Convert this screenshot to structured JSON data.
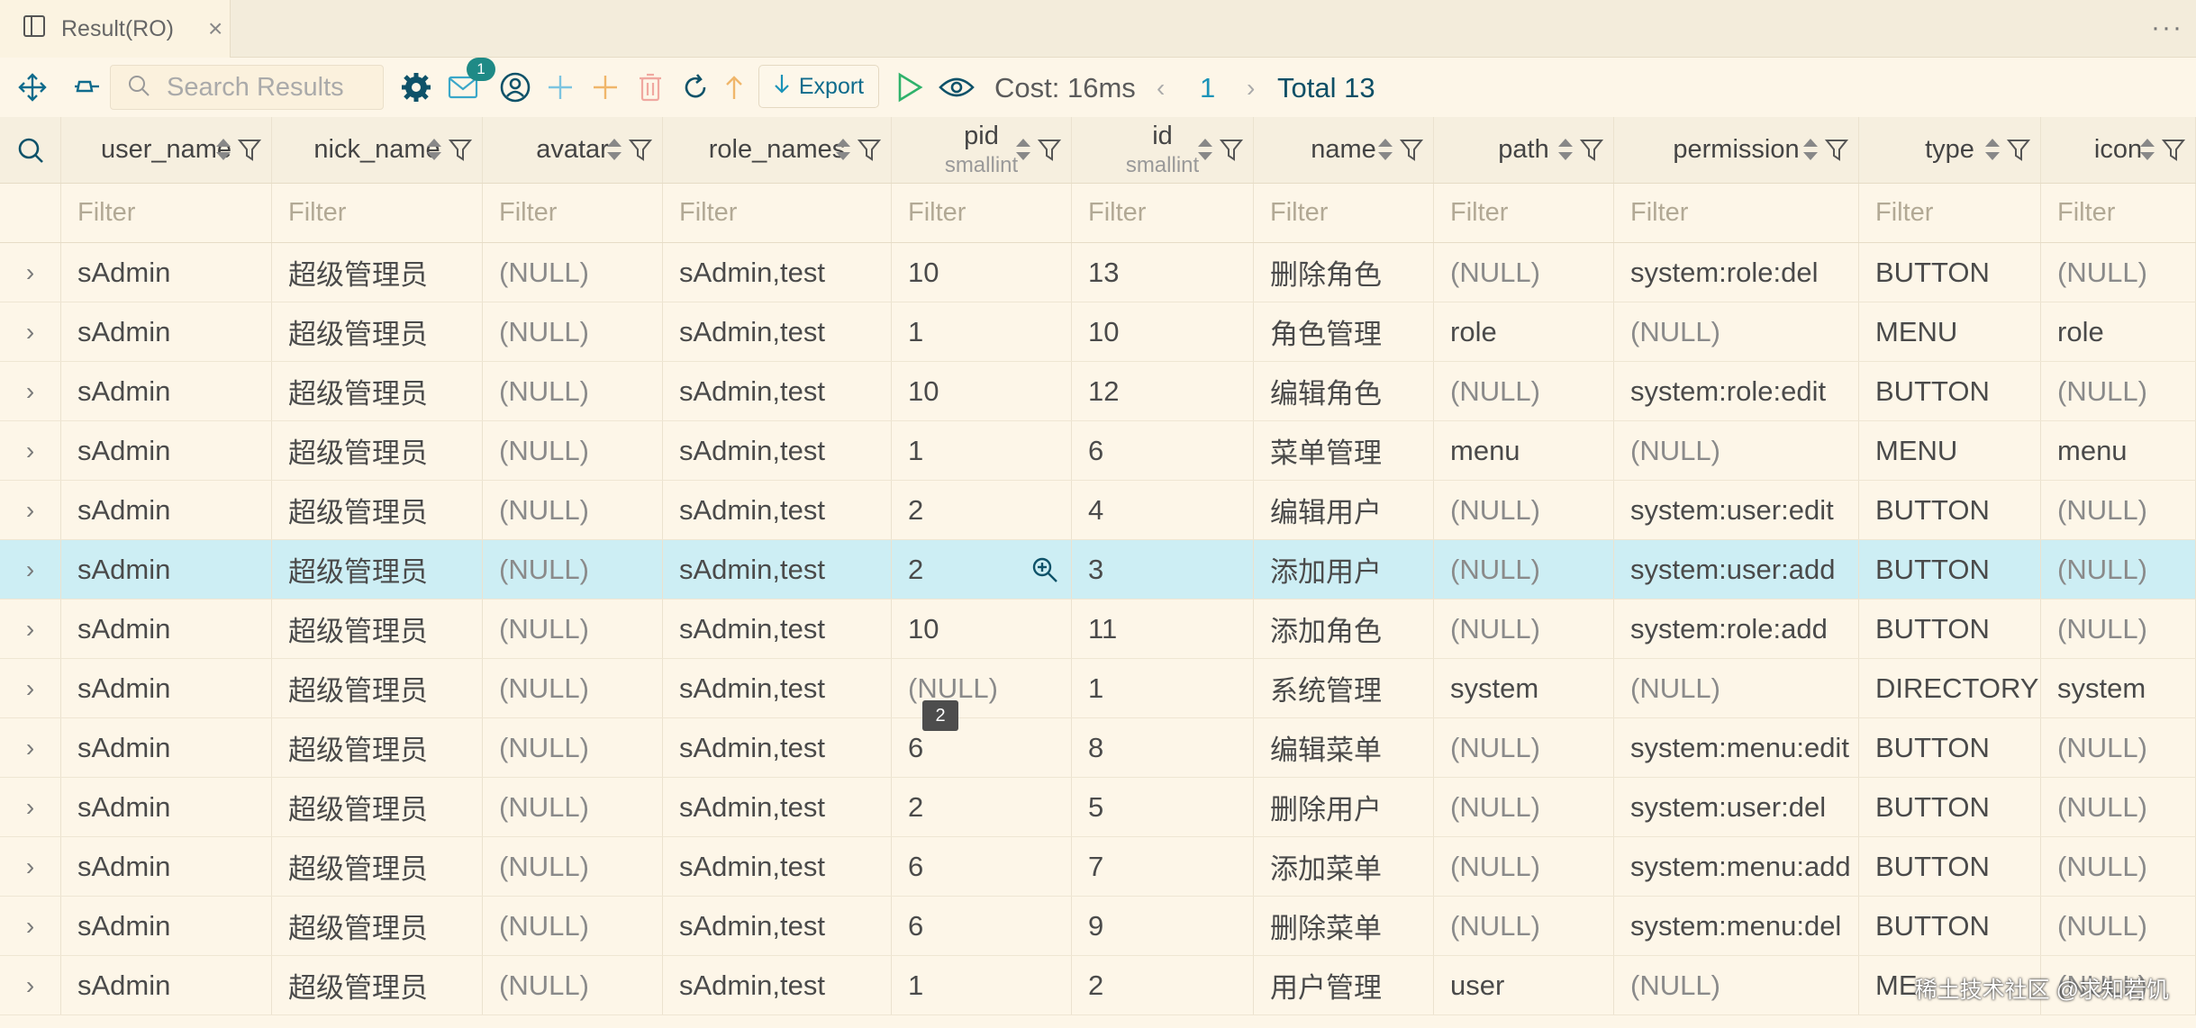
{
  "tab": {
    "title": "Result(RO)"
  },
  "toolbar": {
    "search_placeholder": "Search Results",
    "notification_count": "1",
    "export_label": "Export",
    "cost_label": "Cost: 16ms",
    "page_number": "1",
    "total_label": "Total 13"
  },
  "columns": [
    {
      "name": "user_name",
      "type": ""
    },
    {
      "name": "nick_name",
      "type": ""
    },
    {
      "name": "avatar",
      "type": ""
    },
    {
      "name": "role_names",
      "type": ""
    },
    {
      "name": "pid",
      "type": "smallint"
    },
    {
      "name": "id",
      "type": "smallint"
    },
    {
      "name": "name",
      "type": ""
    },
    {
      "name": "path",
      "type": ""
    },
    {
      "name": "permission",
      "type": ""
    },
    {
      "name": "type",
      "type": ""
    },
    {
      "name": "icon",
      "type": ""
    }
  ],
  "filter_placeholder": "Filter",
  "rows": [
    [
      "sAdmin",
      "超级管理员",
      "(NULL)",
      "sAdmin,test",
      "10",
      "13",
      "删除角色",
      "(NULL)",
      "system:role:del",
      "BUTTON",
      "(NULL)"
    ],
    [
      "sAdmin",
      "超级管理员",
      "(NULL)",
      "sAdmin,test",
      "1",
      "10",
      "角色管理",
      "role",
      "(NULL)",
      "MENU",
      "role"
    ],
    [
      "sAdmin",
      "超级管理员",
      "(NULL)",
      "sAdmin,test",
      "10",
      "12",
      "编辑角色",
      "(NULL)",
      "system:role:edit",
      "BUTTON",
      "(NULL)"
    ],
    [
      "sAdmin",
      "超级管理员",
      "(NULL)",
      "sAdmin,test",
      "1",
      "6",
      "菜单管理",
      "menu",
      "(NULL)",
      "MENU",
      "menu"
    ],
    [
      "sAdmin",
      "超级管理员",
      "(NULL)",
      "sAdmin,test",
      "2",
      "4",
      "编辑用户",
      "(NULL)",
      "system:user:edit",
      "BUTTON",
      "(NULL)"
    ],
    [
      "sAdmin",
      "超级管理员",
      "(NULL)",
      "sAdmin,test",
      "2",
      "3",
      "添加用户",
      "(NULL)",
      "system:user:add",
      "BUTTON",
      "(NULL)"
    ],
    [
      "sAdmin",
      "超级管理员",
      "(NULL)",
      "sAdmin,test",
      "10",
      "11",
      "添加角色",
      "(NULL)",
      "system:role:add",
      "BUTTON",
      "(NULL)"
    ],
    [
      "sAdmin",
      "超级管理员",
      "(NULL)",
      "sAdmin,test",
      "(NULL)",
      "1",
      "系统管理",
      "system",
      "(NULL)",
      "DIRECTORY",
      "system"
    ],
    [
      "sAdmin",
      "超级管理员",
      "(NULL)",
      "sAdmin,test",
      "6",
      "8",
      "编辑菜单",
      "(NULL)",
      "system:menu:edit",
      "BUTTON",
      "(NULL)"
    ],
    [
      "sAdmin",
      "超级管理员",
      "(NULL)",
      "sAdmin,test",
      "2",
      "5",
      "删除用户",
      "(NULL)",
      "system:user:del",
      "BUTTON",
      "(NULL)"
    ],
    [
      "sAdmin",
      "超级管理员",
      "(NULL)",
      "sAdmin,test",
      "6",
      "7",
      "添加菜单",
      "(NULL)",
      "system:menu:add",
      "BUTTON",
      "(NULL)"
    ],
    [
      "sAdmin",
      "超级管理员",
      "(NULL)",
      "sAdmin,test",
      "6",
      "9",
      "删除菜单",
      "(NULL)",
      "system:menu:del",
      "BUTTON",
      "(NULL)"
    ],
    [
      "sAdmin",
      "超级管理员",
      "(NULL)",
      "sAdmin,test",
      "1",
      "2",
      "用户管理",
      "user",
      "(NULL)",
      "ME",
      "(NULL)"
    ]
  ],
  "selected_row_index": 5,
  "hover_tooltip": "2",
  "watermark": "稀土技术社区 @求知若饥",
  "colors": {
    "accent": "#1a93b8",
    "selected_row": "#cdeef4",
    "background": "#fdf6e8"
  }
}
